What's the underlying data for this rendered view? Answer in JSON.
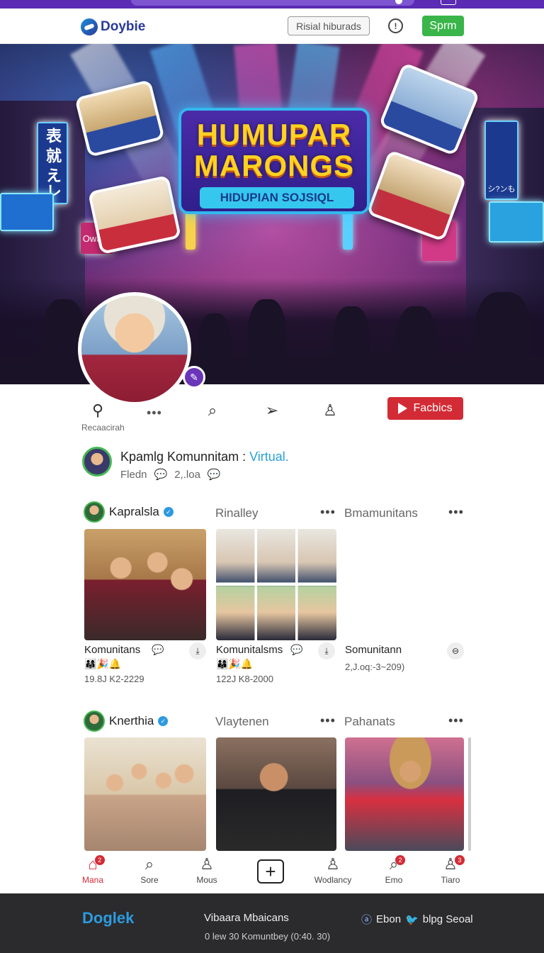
{
  "header": {
    "logo_text": "Doybie",
    "outline_button": "Risial hiburads",
    "info_icon": "info-icon",
    "primary_button": "Sprm",
    "accent_color": "#3ab54a",
    "topbar_color": "#5b2bb3"
  },
  "hero": {
    "title_line1": "HUMUPAR",
    "title_line2": "MARONGS",
    "subtitle": "HIDUPIAN SOJSIQL",
    "neon_signs": [
      "表 就 えレ",
      "Owaca",
      "シ?ンも"
    ]
  },
  "actions": {
    "items": [
      {
        "icon": "pin-icon",
        "label": "Recaacirah"
      },
      {
        "icon": "search-icon"
      },
      {
        "icon": "send-icon"
      },
      {
        "icon": "user-icon"
      }
    ],
    "video_button": "Facbics",
    "video_color": "#d32b35"
  },
  "community": {
    "title": "Kpamlg Komunnitam :",
    "title_accent": "Virtual.",
    "meta_name": "Fledn",
    "meta_count": "2,.loa"
  },
  "section1": {
    "user": "Kapralsla",
    "col2": "Rinalley",
    "col3": "Bmamunitans",
    "cards": [
      {
        "caption": "Komunitans",
        "emoji": "👨‍👩‍👧🎉🔔",
        "sub": "19.8J K2-2229"
      },
      {
        "caption": "Komunitalsms",
        "emoji": "👨‍👩‍👦🎉🔔",
        "sub": "122J K8-2000"
      },
      {
        "caption": "Somunitann",
        "emoji": "",
        "sub": "2,J.oq:-3~209)"
      }
    ]
  },
  "section2": {
    "user": "Knerthia",
    "col2": "Vlaytenen",
    "col3": "Pahanats"
  },
  "tabbar": {
    "tabs": [
      {
        "label": "Mana",
        "icon": "home-icon",
        "badge": "2"
      },
      {
        "label": "Sore",
        "icon": "search-icon",
        "badge": ""
      },
      {
        "label": "Mous",
        "icon": "user-icon",
        "badge": ""
      },
      {
        "label": "Wodlancy",
        "icon": "user-icon",
        "badge": ""
      },
      {
        "label": "Emo",
        "icon": "search-icon",
        "badge": "2"
      },
      {
        "label": "Tiaro",
        "icon": "people-icon",
        "badge": "3"
      }
    ]
  },
  "footer": {
    "logo": "Doglek",
    "middle": "Vibaara Mbaicans",
    "right_a": "Ebon",
    "right_b": "blpg Seoal",
    "bottom": "0 lew 30 Komuntbey (0:40. 30)"
  }
}
